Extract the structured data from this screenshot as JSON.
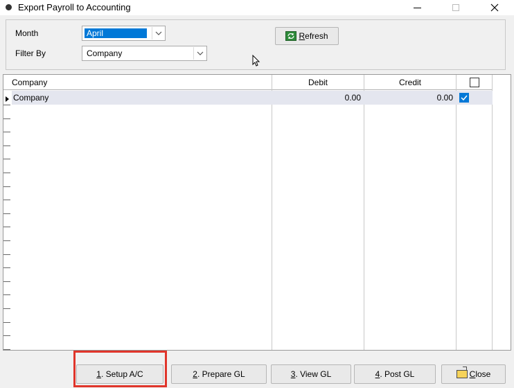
{
  "window": {
    "title": "Export Payroll to Accounting",
    "icons": [
      "app-icon",
      "minimize-icon",
      "maximize-icon",
      "close-icon"
    ]
  },
  "filters": {
    "month_label": "Month",
    "month_value": "April",
    "filter_by_label": "Filter By",
    "filter_by_value": "Company"
  },
  "toolbar": {
    "refresh_label": "Refresh",
    "refresh_mnemonic": "R",
    "refresh_rest": "efresh"
  },
  "grid": {
    "columns": [
      "Company",
      "Debit",
      "Credit"
    ],
    "rows": [
      {
        "company": "Company",
        "debit": "0.00",
        "credit": "0.00",
        "checked": true
      }
    ]
  },
  "buttons": {
    "setup": {
      "mnemonic": "1",
      "rest": ". Setup A/C"
    },
    "prepare": {
      "mnemonic": "2",
      "rest": ". Prepare GL"
    },
    "view": {
      "mnemonic": "3",
      "rest": ". View GL"
    },
    "post": {
      "mnemonic": "4",
      "rest": ". Post GL"
    },
    "close": {
      "mnemonic": "C",
      "rest": "lose"
    }
  },
  "colors": {
    "selection": "#0078d7",
    "highlight_box": "#e0352b",
    "row_selected": "#e4e6ef"
  }
}
